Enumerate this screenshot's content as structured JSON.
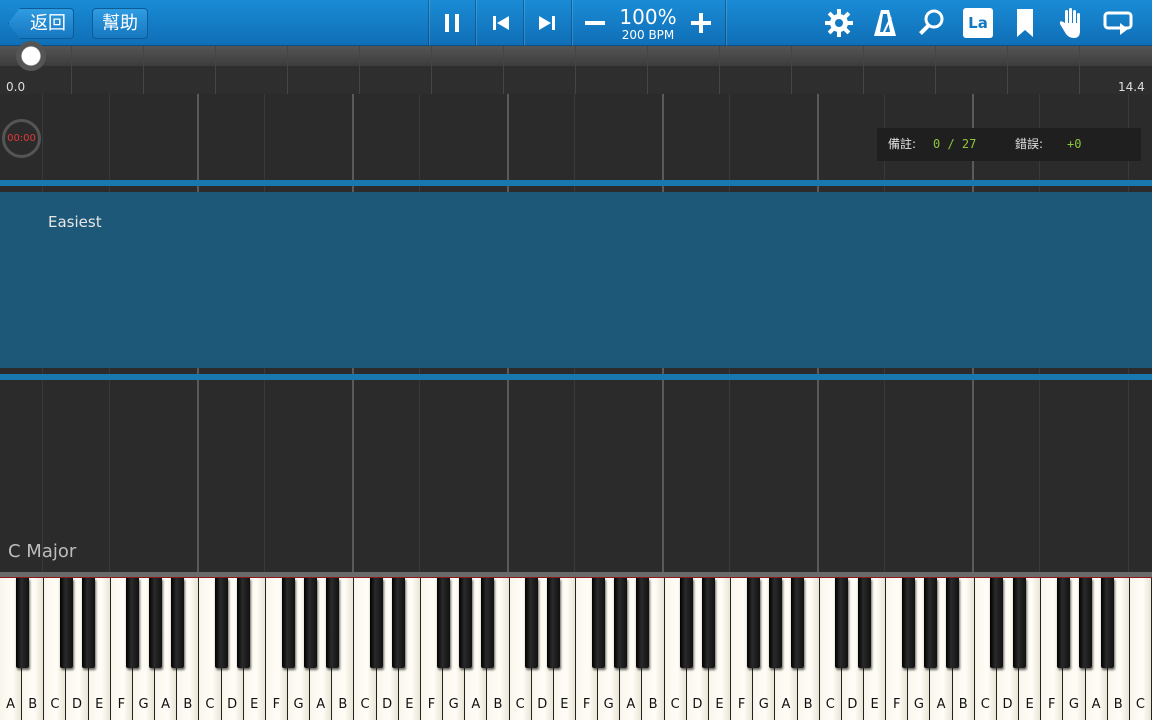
{
  "toolbar": {
    "back_label": "返回",
    "help_label": "幫助",
    "tempo_percent": "100%",
    "tempo_bpm": "200 BPM",
    "icons": [
      "pause-icon",
      "skip-back-icon",
      "skip-forward-icon",
      "minus-icon",
      "plus-icon",
      "gear-icon",
      "metronome-icon",
      "search-icon",
      "note-label-icon",
      "bookmark-icon",
      "hand-icon",
      "loop-icon"
    ],
    "note_label_icon_text": "La"
  },
  "ruler": {
    "start_label": "0.0",
    "end_label": "14.4"
  },
  "roll": {
    "timer": "00:00",
    "difficulty": "Easiest",
    "key_signature": "C Major",
    "stats": {
      "notes_label": "備註:",
      "notes_value": "0 / 27",
      "errors_label": "錯誤:",
      "errors_value": "+0"
    }
  },
  "piano": {
    "white_keys": [
      "A",
      "B",
      "C",
      "D",
      "E",
      "F",
      "G",
      "A",
      "B",
      "C",
      "D",
      "E",
      "F",
      "G",
      "A",
      "B",
      "C",
      "D",
      "E",
      "F",
      "G",
      "A",
      "B",
      "C",
      "D",
      "E",
      "F",
      "G",
      "A",
      "B",
      "C",
      "D",
      "E",
      "F",
      "G",
      "A",
      "B",
      "C",
      "D",
      "E",
      "F",
      "G",
      "A",
      "B",
      "C",
      "D",
      "E",
      "F",
      "G",
      "A",
      "B",
      "C"
    ]
  },
  "colors": {
    "toolbar": "#1a8bd6",
    "band": "#1e5878",
    "band_edge": "#1a78b0",
    "timer": "#e03a3a",
    "stats_value": "#8cc63f"
  }
}
